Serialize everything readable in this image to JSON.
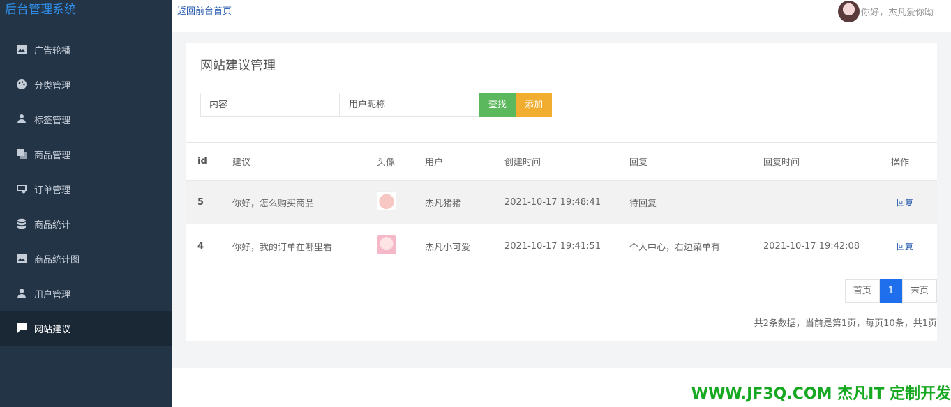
{
  "brand": "后台管理系统",
  "sidebar": {
    "items": [
      {
        "label": "广告轮播",
        "icon": "image-icon"
      },
      {
        "label": "分类管理",
        "icon": "palette-icon"
      },
      {
        "label": "标签管理",
        "icon": "user-tag-icon"
      },
      {
        "label": "商品管理",
        "icon": "copy-icon"
      },
      {
        "label": "订单管理",
        "icon": "screen-search-icon"
      },
      {
        "label": "商品统计",
        "icon": "database-icon"
      },
      {
        "label": "商品统计图",
        "icon": "image-icon"
      },
      {
        "label": "用户管理",
        "icon": "user-icon"
      },
      {
        "label": "网站建议",
        "icon": "chat-icon",
        "active": true
      }
    ]
  },
  "topbar": {
    "back_label": "返回前台首页",
    "greeting": "你好，杰凡爱你呦"
  },
  "panel": {
    "title": "网站建议管理",
    "search": {
      "content_placeholder": "内容",
      "user_placeholder": "用户昵称",
      "find_label": "查找",
      "add_label": "添加"
    },
    "table": {
      "headers": [
        "id",
        "建议",
        "头像",
        "用户",
        "创建时间",
        "回复",
        "回复时间",
        "操作"
      ],
      "rows": [
        {
          "id": "5",
          "suggestion": "你好，怎么购买商品",
          "user": "杰凡猪猪",
          "created": "2021-10-17 19:48:41",
          "reply": "待回复",
          "reply_time": "",
          "action": "回复"
        },
        {
          "id": "4",
          "suggestion": "你好，我的订单在哪里看",
          "user": "杰凡小可爱",
          "created": "2021-10-17 19:41:51",
          "reply": "个人中心，右边菜单有",
          "reply_time": "2021-10-17 19:42:08",
          "action": "回复"
        }
      ]
    },
    "pager": {
      "first": "首页",
      "current": "1",
      "last": "末页",
      "info": "共2条数据，当前是第1页，每页10条，共1页"
    }
  },
  "watermark": "WWW.JF3Q.COM 杰凡IT  定制开发"
}
